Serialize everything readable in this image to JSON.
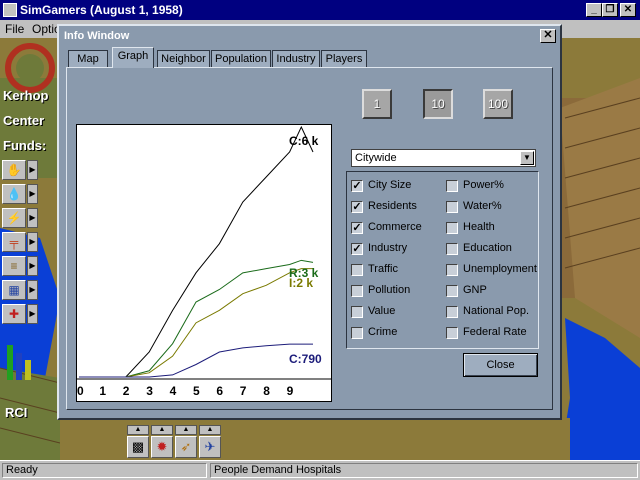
{
  "app": {
    "title": "SimGamers (August 1, 1958)",
    "min_glyph": "_",
    "max_glyph": "❐",
    "close_glyph": "✕"
  },
  "menubar": {
    "items": [
      "File",
      "Optio"
    ]
  },
  "left_panel": {
    "city_name_1": "Kerhop",
    "city_name_2": "Center",
    "funds_label": "Funds:",
    "rci_label": "RCI"
  },
  "tools": [
    "bulldozer-icon",
    "water-icon",
    "power-icon",
    "pipe-icon",
    "rail-icon",
    "zone-icon",
    "emergency-icon"
  ],
  "bottom_tools": [
    "landscape-icon",
    "fire-icon",
    "rocket-icon",
    "airport-icon"
  ],
  "status": {
    "left": "Ready",
    "right": "People Demand Hospitals"
  },
  "info_window": {
    "title": "Info Window",
    "close_glyph": "✕",
    "tabs": [
      "Map",
      "Graph",
      "Neighbor",
      "Population",
      "Industry",
      "Players"
    ],
    "active_tab": "Graph",
    "scale_buttons": [
      "1",
      "10",
      "100"
    ],
    "active_scale": "10",
    "region": "Citywide",
    "options_left": [
      {
        "label": "City Size",
        "checked": true
      },
      {
        "label": "Residents",
        "checked": true
      },
      {
        "label": "Commerce",
        "checked": true
      },
      {
        "label": "Industry",
        "checked": true
      },
      {
        "label": "Traffic",
        "checked": false
      },
      {
        "label": "Pollution",
        "checked": false
      },
      {
        "label": "Value",
        "checked": false
      },
      {
        "label": "Crime",
        "checked": false
      }
    ],
    "options_right": [
      {
        "label": "Power%",
        "checked": false
      },
      {
        "label": "Water%",
        "checked": false
      },
      {
        "label": "Health",
        "checked": false
      },
      {
        "label": "Education",
        "checked": false
      },
      {
        "label": "Unemployment",
        "checked": false
      },
      {
        "label": "GNP",
        "checked": false
      },
      {
        "label": "National Pop.",
        "checked": false
      },
      {
        "label": "Federal Rate",
        "checked": false
      }
    ],
    "close_label": "Close"
  },
  "chart_data": {
    "type": "line",
    "x_tick_labels": [
      "0",
      "1",
      "2",
      "3",
      "4",
      "5",
      "6",
      "7",
      "8",
      "9"
    ],
    "x": [
      0,
      1,
      2,
      3,
      4,
      5,
      6,
      7,
      8,
      9,
      9.5,
      10
    ],
    "series": [
      {
        "name": "C:6 k",
        "color": "#000000",
        "values": [
          0,
          0,
          0,
          600,
          1600,
          2500,
          3200,
          4200,
          4800,
          5400,
          6000,
          5400
        ]
      },
      {
        "name": "R:3 k",
        "color": "#1a6b1a",
        "values": [
          0,
          0,
          0,
          150,
          800,
          1800,
          2100,
          2500,
          2600,
          2700,
          2800,
          2750
        ]
      },
      {
        "name": "I:2 k",
        "color": "#7a7a00",
        "values": [
          0,
          0,
          0,
          100,
          500,
          1300,
          1600,
          2000,
          2200,
          2500,
          2600,
          2600
        ]
      },
      {
        "name": "C:790",
        "color": "#1c1c7a",
        "values": [
          0,
          0,
          0,
          0,
          50,
          300,
          600,
          700,
          750,
          790,
          790,
          790
        ]
      }
    ],
    "end_labels": [
      "C:6 k",
      "R:3 k",
      "I:2 k",
      "C:790"
    ],
    "ylim": [
      0,
      6000
    ],
    "xlim": [
      0,
      10
    ],
    "grid": false,
    "legend": "none"
  }
}
